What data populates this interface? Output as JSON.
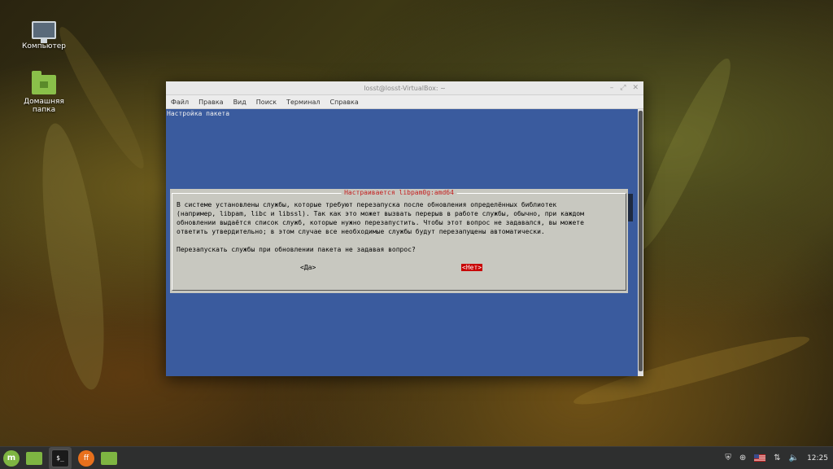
{
  "desktop": {
    "icons": [
      {
        "label": "Компьютер",
        "icon": "computer-icon"
      },
      {
        "label": "Домашняя папка",
        "icon": "home-folder-icon"
      }
    ]
  },
  "window": {
    "title": "losst@losst-VirtualBox: ~",
    "buttons": {
      "minimize": "–",
      "maximize": "⤢",
      "close": "✕"
    },
    "menu": [
      "Файл",
      "Правка",
      "Вид",
      "Поиск",
      "Терминал",
      "Справка"
    ]
  },
  "terminal": {
    "header": "Настройка пакета",
    "colors": {
      "background": "#3a5b9e",
      "dialog": "#c8c8c0",
      "title": "#c42020",
      "selected": "#c80000"
    }
  },
  "dialog": {
    "title": "Настраивается libpam0g:amd64",
    "lines": [
      "В системе установлены службы, которые требуют перезапуска после обновления определённых библиотек",
      "(например, libpam, libc и libssl). Так как это может вызвать перерыв в работе службы, обычно, при каждом",
      "обновлении выдаётся список служб, которые нужно перезапустить. Чтобы этот вопрос не задавался, вы можете",
      "ответить утвердительно; в этом случае все необходимые службы будут перезапущены автоматически."
    ],
    "question": "Перезапускать службы при обновлении пакета не задавая вопрос?",
    "yes": "<Да>",
    "no": "<Нет>"
  },
  "taskbar": {
    "terminal_label": "$_",
    "clock": "12:25",
    "tray": [
      "shield-icon",
      "update-icon",
      "flag-us-icon",
      "network-icon",
      "volume-icon"
    ]
  }
}
